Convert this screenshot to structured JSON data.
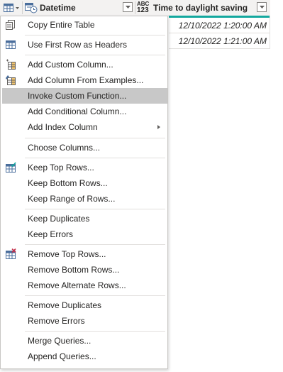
{
  "header": {
    "col1_name": "Datetime",
    "col1_type_icon": "datetime-type-icon",
    "col2_name": "Time to daylight saving",
    "col2_type_label_top": "ABC",
    "col2_type_label_bottom": "123",
    "accent_color": "#13a89e"
  },
  "rows": [
    {
      "time_to_daylight_saving": "12/10/2022 1:20:00 AM"
    },
    {
      "time_to_daylight_saving": "12/10/2022 1:21:00 AM"
    }
  ],
  "menu": {
    "highlight_color": "#c8c8c8",
    "items": [
      {
        "label": "Copy Entire Table",
        "icon": "copy-table-icon"
      },
      {
        "label": "Use First Row as Headers",
        "icon": "table-headers-icon"
      },
      {
        "label": "Add Custom Column...",
        "icon": "custom-column-icon"
      },
      {
        "label": "Add Column From Examples...",
        "icon": "column-from-examples-icon"
      },
      {
        "label": "Invoke Custom Function...",
        "highlighted": true
      },
      {
        "label": "Add Conditional Column..."
      },
      {
        "label": "Add Index Column",
        "submenu": true
      },
      {
        "label": "Choose Columns..."
      },
      {
        "label": "Keep Top Rows...",
        "icon": "keep-rows-icon"
      },
      {
        "label": "Keep Bottom Rows..."
      },
      {
        "label": "Keep Range of Rows..."
      },
      {
        "label": "Keep Duplicates"
      },
      {
        "label": "Keep Errors"
      },
      {
        "label": "Remove Top Rows...",
        "icon": "remove-rows-icon"
      },
      {
        "label": "Remove Bottom Rows..."
      },
      {
        "label": "Remove Alternate Rows..."
      },
      {
        "label": "Remove Duplicates"
      },
      {
        "label": "Remove Errors"
      },
      {
        "label": "Merge Queries..."
      },
      {
        "label": "Append Queries..."
      }
    ]
  }
}
